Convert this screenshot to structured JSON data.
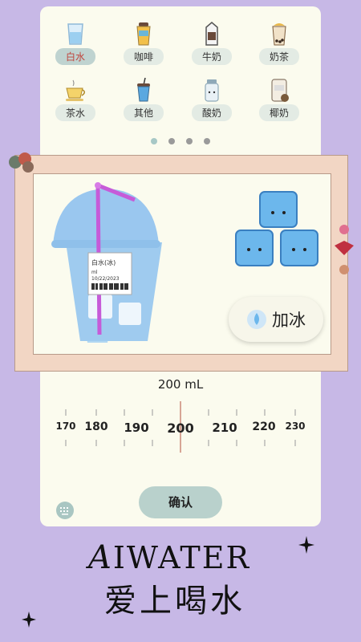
{
  "drinks": [
    {
      "label": "白水",
      "icon": "water-glass-icon",
      "selected": true
    },
    {
      "label": "咖啡",
      "icon": "coffee-cup-icon",
      "selected": false
    },
    {
      "label": "牛奶",
      "icon": "milk-carton-icon",
      "selected": false
    },
    {
      "label": "奶茶",
      "icon": "milk-tea-icon",
      "selected": false
    },
    {
      "label": "茶水",
      "icon": "tea-cup-icon",
      "selected": false
    },
    {
      "label": "其他",
      "icon": "soda-cup-icon",
      "selected": false
    },
    {
      "label": "酸奶",
      "icon": "yogurt-jar-icon",
      "selected": false
    },
    {
      "label": "椰奶",
      "icon": "coconut-milk-icon",
      "selected": false
    }
  ],
  "pager": {
    "count": 4,
    "active": 0
  },
  "cup": {
    "label_name": "白水(冰)",
    "label_sub": "ml",
    "label_date": "10/22/2023"
  },
  "ice_button": {
    "label": "加冰",
    "icon": "water-drop-icon"
  },
  "volume": {
    "text": "200 mL",
    "value": 200
  },
  "ruler": {
    "ticks": [
      "170",
      "180",
      "190",
      "200",
      "210",
      "220",
      "230"
    ]
  },
  "confirm": {
    "label": "确认"
  },
  "keyboard_icon": "keyboard-icon",
  "brand": {
    "en_initial": "A",
    "en_rest": "IWATER",
    "cn": "爱上喝水"
  },
  "colors": {
    "background": "#c7b8e6",
    "accent": "#bfd3d0",
    "selected_text": "#c0443c",
    "frame": "#f2d6c4"
  }
}
